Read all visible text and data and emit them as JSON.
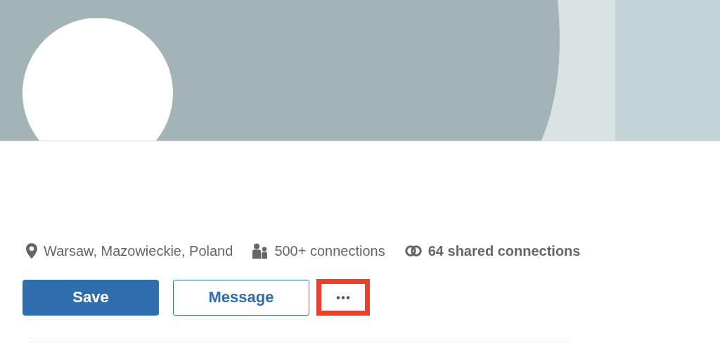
{
  "profile": {
    "avatar": {
      "kind": "blank"
    }
  },
  "meta": [
    {
      "kind": "location",
      "text": "Warsaw, Mazowieckie, Poland"
    },
    {
      "kind": "connections",
      "text": "500+ connections"
    },
    {
      "kind": "shared",
      "text": "64 shared connections"
    }
  ],
  "actions": [
    {
      "kind": "primary",
      "label": "Save"
    },
    {
      "kind": "secondary",
      "label": "Message"
    },
    {
      "kind": "more",
      "highlighted": true
    }
  ]
}
